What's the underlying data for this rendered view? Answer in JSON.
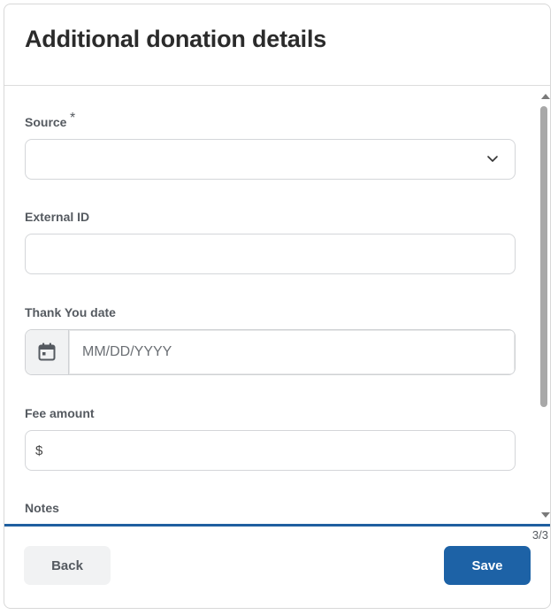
{
  "dialog": {
    "title": "Additional donation details"
  },
  "form": {
    "source": {
      "label": "Source",
      "required_mark": "*",
      "value": ""
    },
    "external_id": {
      "label": "External ID",
      "value": ""
    },
    "thank_you_date": {
      "label": "Thank You date",
      "placeholder": "MM/DD/YYYY",
      "icon": "calendar-icon"
    },
    "fee_amount": {
      "label": "Fee amount",
      "currency_symbol": "$",
      "value": ""
    },
    "notes": {
      "label": "Notes"
    }
  },
  "footer": {
    "step_indicator": "3/3",
    "back_label": "Back",
    "save_label": "Save"
  },
  "colors": {
    "primary": "#1d62a6",
    "progress": "#1f5fa0",
    "secondary_button_bg": "#f1f2f3",
    "label_text": "#555a60"
  }
}
